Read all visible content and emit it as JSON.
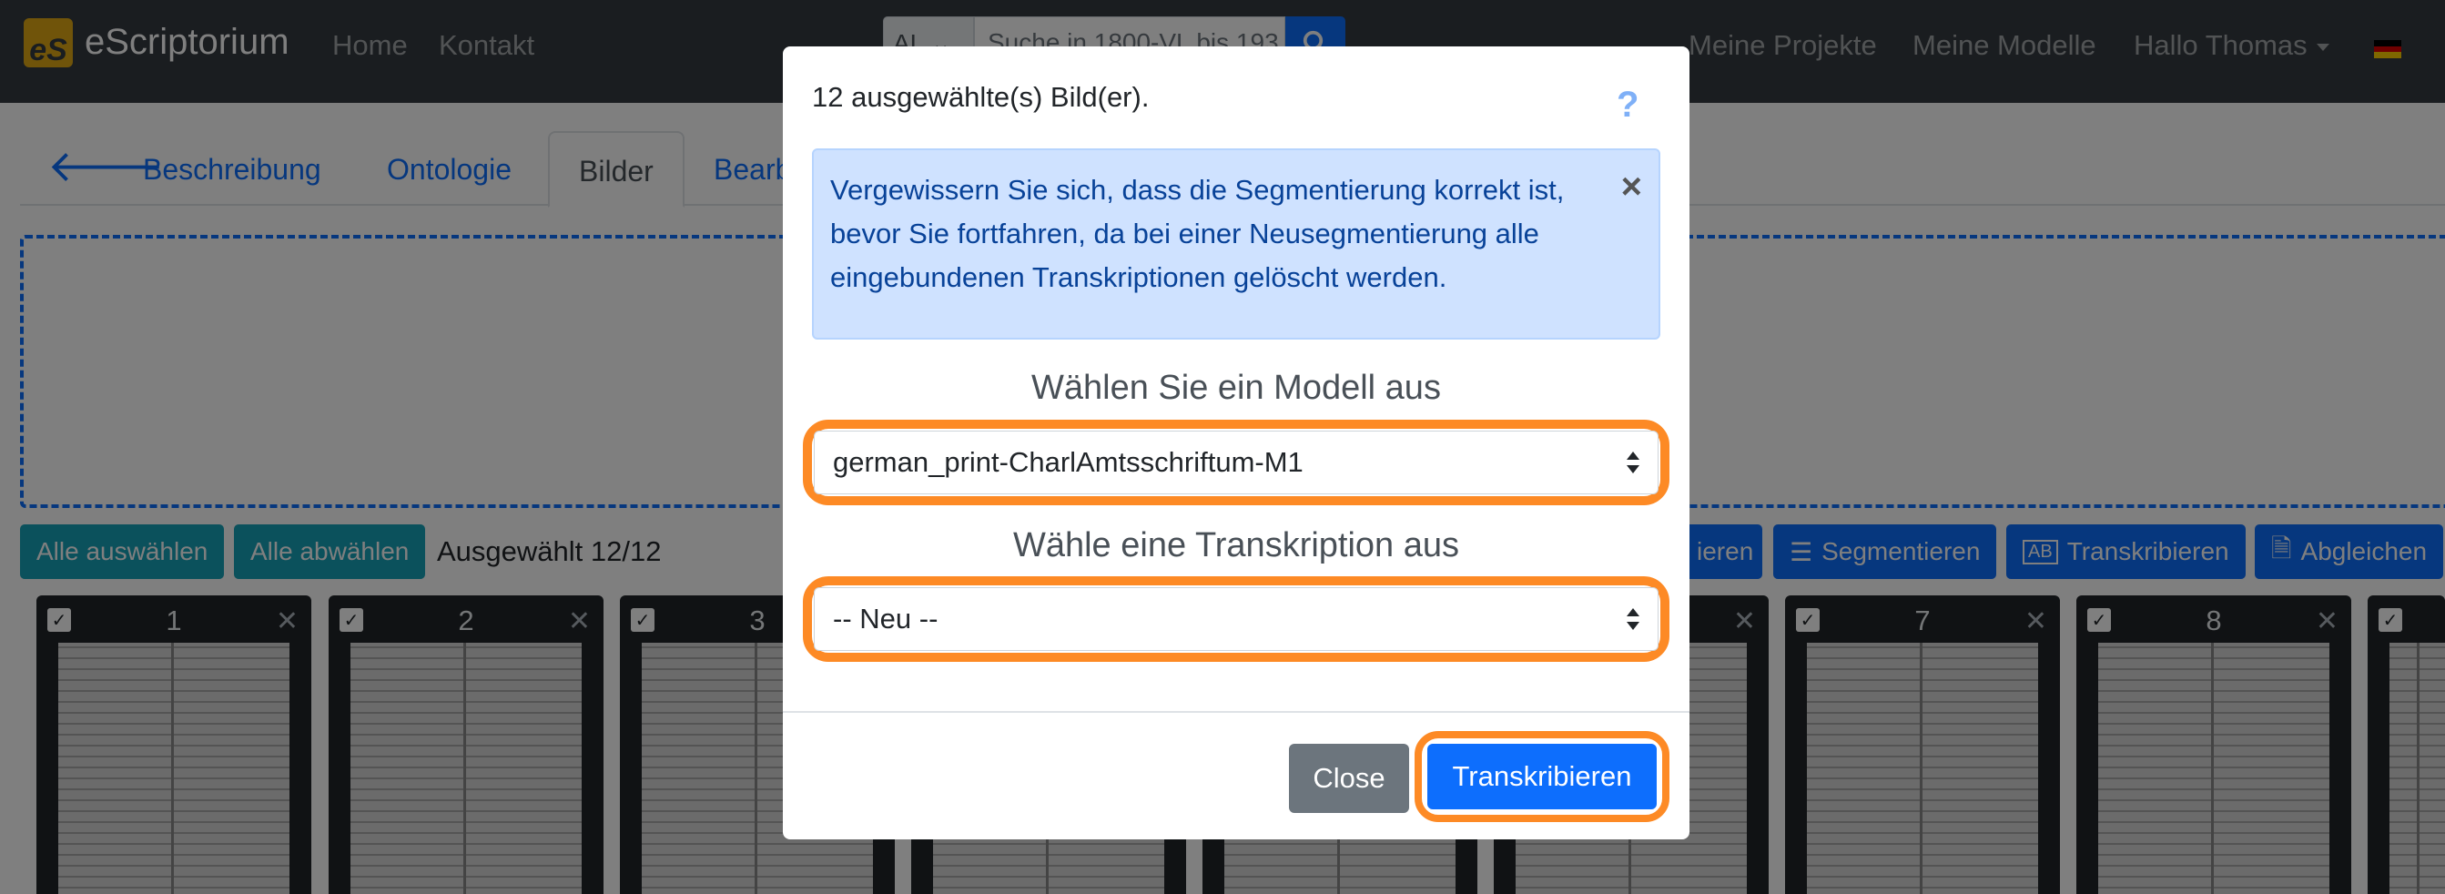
{
  "navbar": {
    "brand_logo_text": "eS",
    "brand": "eScriptorium",
    "links": [
      "Home",
      "Kontakt"
    ],
    "search_scope": "AL",
    "search_placeholder": "Suche in 1800-VL bis 193",
    "right_links": [
      "Meine Projekte",
      "Meine Modelle"
    ],
    "user_menu": "Hallo Thomas"
  },
  "tabs": [
    "Beschreibung",
    "Ontologie",
    "Bilder",
    "Bearb"
  ],
  "toolbar": {
    "select_all": "Alle auswählen",
    "deselect_all": "Alle abwählen",
    "selected": "Ausgewählt 12/12",
    "actions": [
      "ieren",
      "Segmentieren",
      "Transkribieren",
      "Abgleichen"
    ]
  },
  "thumbnails": [
    "1",
    "2",
    "3",
    "",
    "",
    "",
    "7",
    "8",
    ""
  ],
  "modal": {
    "title": "12 ausgewählte(s) Bild(er).",
    "help": "?",
    "alert": "Vergewissern Sie sich, dass die Segmentierung korrekt ist, bevor Sie fortfahren, da bei einer Neusegmentierung alle eingebundenen Transkriptionen gelöscht werden.",
    "alert_close": "×",
    "model_label": "Wählen Sie ein Modell aus",
    "model_value": "german_print-CharlAmtsschriftum-M1",
    "transcription_label": "Wähle eine Transkription aus",
    "transcription_value": "-- Neu --",
    "close": "Close",
    "submit": "Transkribieren"
  },
  "colors": {
    "navbar": "#343a40",
    "primary": "#0d6efd",
    "teal": "#17a2b8",
    "highlight": "#fd8a25",
    "alert_bg": "#cfe2ff"
  }
}
